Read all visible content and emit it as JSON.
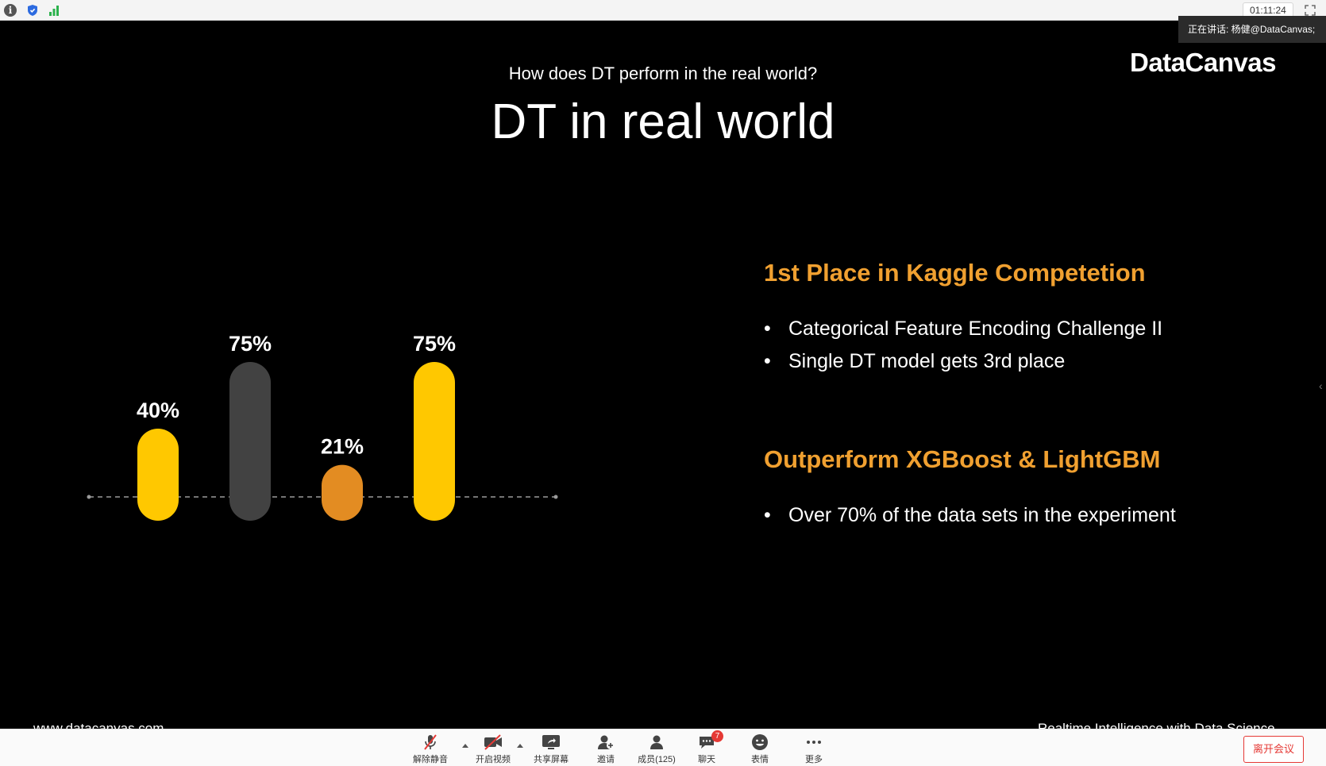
{
  "topbar": {
    "timer": "01:11:24",
    "speaking_label": "正在讲话: 杨健@DataCanvas;"
  },
  "slide": {
    "subtitle": "How does DT perform in the real world?",
    "title": "DT in real world",
    "logo": "DataCanvas",
    "sections": [
      {
        "heading": "1st Place in Kaggle Competetion",
        "bullets": [
          "Categorical Feature Encoding Challenge II",
          "Single DT model gets 3rd place"
        ]
      },
      {
        "heading": "Outperform XGBoost & LightGBM",
        "bullets": [
          "Over 70% of the data sets in the experiment"
        ]
      }
    ],
    "footer_left": "www.datacanvas.com",
    "footer_right": "Realtime Intelligence with Data Science"
  },
  "chart_data": {
    "type": "bar",
    "values": [
      40,
      75,
      21,
      75
    ],
    "labels": [
      "40%",
      "75%",
      "21%",
      "75%"
    ],
    "colors": [
      "#ffc800",
      "#424242",
      "#e38c22",
      "#ffc800"
    ]
  },
  "toolbar": {
    "unmute": "解除静音",
    "start_video": "开启视频",
    "share_screen": "共享屏幕",
    "invite": "邀请",
    "participants": "成员(125)",
    "chat": "聊天",
    "chat_badge": "7",
    "reactions": "表情",
    "more": "更多",
    "leave": "离开会议"
  },
  "colors": {
    "heading": "#f0a030",
    "leave": "#e53935"
  }
}
